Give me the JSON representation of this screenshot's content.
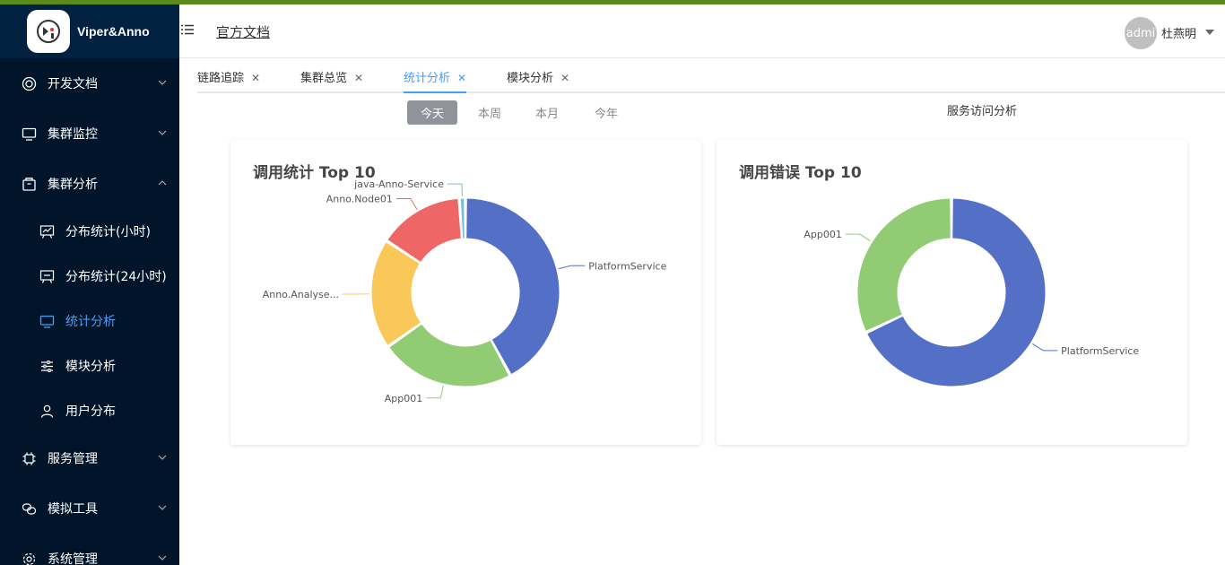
{
  "app": {
    "name": "Viper&Anno"
  },
  "header": {
    "doc_link": "官方文档",
    "avatar_text": "admi",
    "username": "杜燕明"
  },
  "sidebar": {
    "items": [
      {
        "label": "开发文档",
        "icon": "target-icon",
        "expanded": false
      },
      {
        "label": "集群监控",
        "icon": "monitor-icon",
        "expanded": false
      },
      {
        "label": "集群分析",
        "icon": "box-icon",
        "expanded": true
      }
    ],
    "subitems": [
      {
        "label": "分布统计(小时)",
        "icon": "chart-board-icon"
      },
      {
        "label": "分布统计(24小时)",
        "icon": "chart-board-icon"
      },
      {
        "label": "统计分析",
        "icon": "monitor-icon",
        "active": true
      },
      {
        "label": "模块分析",
        "icon": "sliders-icon"
      },
      {
        "label": "用户分布",
        "icon": "user-icon"
      }
    ],
    "bottom_items": [
      {
        "label": "服务管理",
        "icon": "chip-icon"
      },
      {
        "label": "模拟工具",
        "icon": "link-icon"
      },
      {
        "label": "系统管理",
        "icon": "gear-icon"
      }
    ]
  },
  "tabs": [
    {
      "label": "链路追踪",
      "active": false
    },
    {
      "label": "集群总览",
      "active": false
    },
    {
      "label": "统计分析",
      "active": true
    },
    {
      "label": "模块分析",
      "active": false
    }
  ],
  "periods": [
    {
      "label": "今天",
      "active": true
    },
    {
      "label": "本周",
      "active": false
    },
    {
      "label": "本月",
      "active": false
    },
    {
      "label": "今年",
      "active": false
    }
  ],
  "service_title": "服务访问分析",
  "colors": {
    "blue": "#5470c6",
    "green": "#91cc75",
    "yellow": "#fac858",
    "red": "#ee6666",
    "cyan": "#73c0de",
    "active_tab": "#409eff",
    "sidebar_bg": "#001529"
  },
  "chart_data": [
    {
      "type": "pie",
      "title": "调用统计 Top 10",
      "donut": true,
      "labels": [
        "PlatformService",
        "App001",
        "Anno.Analyse...",
        "Anno.Node01",
        "java-Anno-Service"
      ],
      "values": [
        40,
        22,
        18,
        14,
        1
      ],
      "colors": [
        "#5470c6",
        "#91cc75",
        "#fac858",
        "#ee6666",
        "#73c0de"
      ]
    },
    {
      "type": "pie",
      "title": "调用错误 Top 10",
      "donut": true,
      "labels": [
        "PlatformService",
        "App001"
      ],
      "values": [
        68,
        32
      ],
      "colors": [
        "#5470c6",
        "#91cc75"
      ]
    }
  ]
}
